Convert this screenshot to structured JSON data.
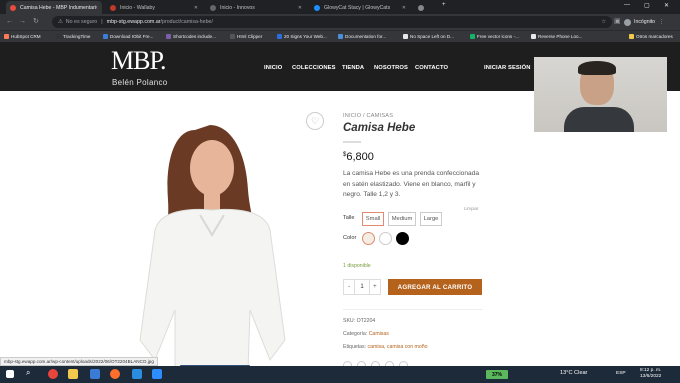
{
  "tabs": [
    {
      "label": "Camisa Hebe - MBP Indumentari",
      "favicon_color": "#e74c3c",
      "active": true
    },
    {
      "label": "Inicio - Wallaby",
      "favicon_color": "#c0392b",
      "active": false
    },
    {
      "label": "Inicio - Innovos",
      "favicon_color": "#666666",
      "active": false
    },
    {
      "label": "GlowyCat Stacy | GlowyCats",
      "favicon_color": "#1e90ff",
      "active": false
    },
    {
      "label": "",
      "favicon_color": "#888888",
      "active": false
    }
  ],
  "address": {
    "secure_label": "No es seguro",
    "host": "mbp-stg.ewapp.com.ar",
    "path": "/product/camisa-hebe/"
  },
  "profile": {
    "label": "Incógnito"
  },
  "bookmarks": [
    {
      "label": "HubSpot CRM",
      "color": "#ff7a59"
    },
    {
      "label": "TrackingTime",
      "color": "#333333"
    },
    {
      "label": "Download IObit Fre...",
      "color": "#3b7dd8"
    },
    {
      "label": "Shortcodes include...",
      "color": "#7b5ea7"
    },
    {
      "label": "Html Clipper",
      "color": "#555555"
    },
    {
      "label": "20 Signs Your Web...",
      "color": "#2d6cdf"
    },
    {
      "label": "Documentation for...",
      "color": "#4a90d9"
    },
    {
      "label": "No Space Left on D...",
      "color": "#e8e8e8"
    },
    {
      "label": "Free vector icons -...",
      "color": "#16b26a"
    },
    {
      "label": "Reverse Phone Loo...",
      "color": "#e8e8e8"
    },
    {
      "label": "Otros marcadores",
      "color": "#f2c94c"
    }
  ],
  "site": {
    "logo": "MBP.",
    "logo_sub": "Belén Polanco",
    "nav": [
      "INICIO",
      "COLECCIONES",
      "TIENDA",
      "NOSOTROS",
      "CONTACTO"
    ],
    "login": "INICIAR SESIÓN"
  },
  "product": {
    "breadcrumb": "INICIO / CAMISAS",
    "title": "Camisa Hebe",
    "currency": "$",
    "price": "6,800",
    "description": "La camisa Hebe es una prenda confeccionada en satén elastizado. Viene en blanco, marfil y negro. Talle 1,2 y 3.",
    "clear_label": "Limpiar",
    "size_label": "Talle",
    "sizes": [
      "Small",
      "Medium",
      "Large"
    ],
    "selected_size": "Small",
    "color_label": "Color",
    "colors": [
      "#f4ede4",
      "#ffffff",
      "#000000"
    ],
    "stock": "1 disponible",
    "qty_minus": "-",
    "qty": "1",
    "qty_plus": "+",
    "add_to_cart": "AGREGAR AL CARRITO",
    "sku_label": "SKU:",
    "sku": "OT2204",
    "category_label": "Categoría:",
    "category": "Camisas",
    "tags_label": "Etiquetas:",
    "tags": "camisa, camisa con moño"
  },
  "status_url": "mbp-stg.ewapp.com.ar/wp-content/uploads/2022/06/OT2204BLANCO.jpg",
  "taskbar": {
    "battery": "37%",
    "weather": "13°C  Clear",
    "lang": "ESP",
    "time": "8:12 p. m.",
    "date": "13/6/2022"
  }
}
